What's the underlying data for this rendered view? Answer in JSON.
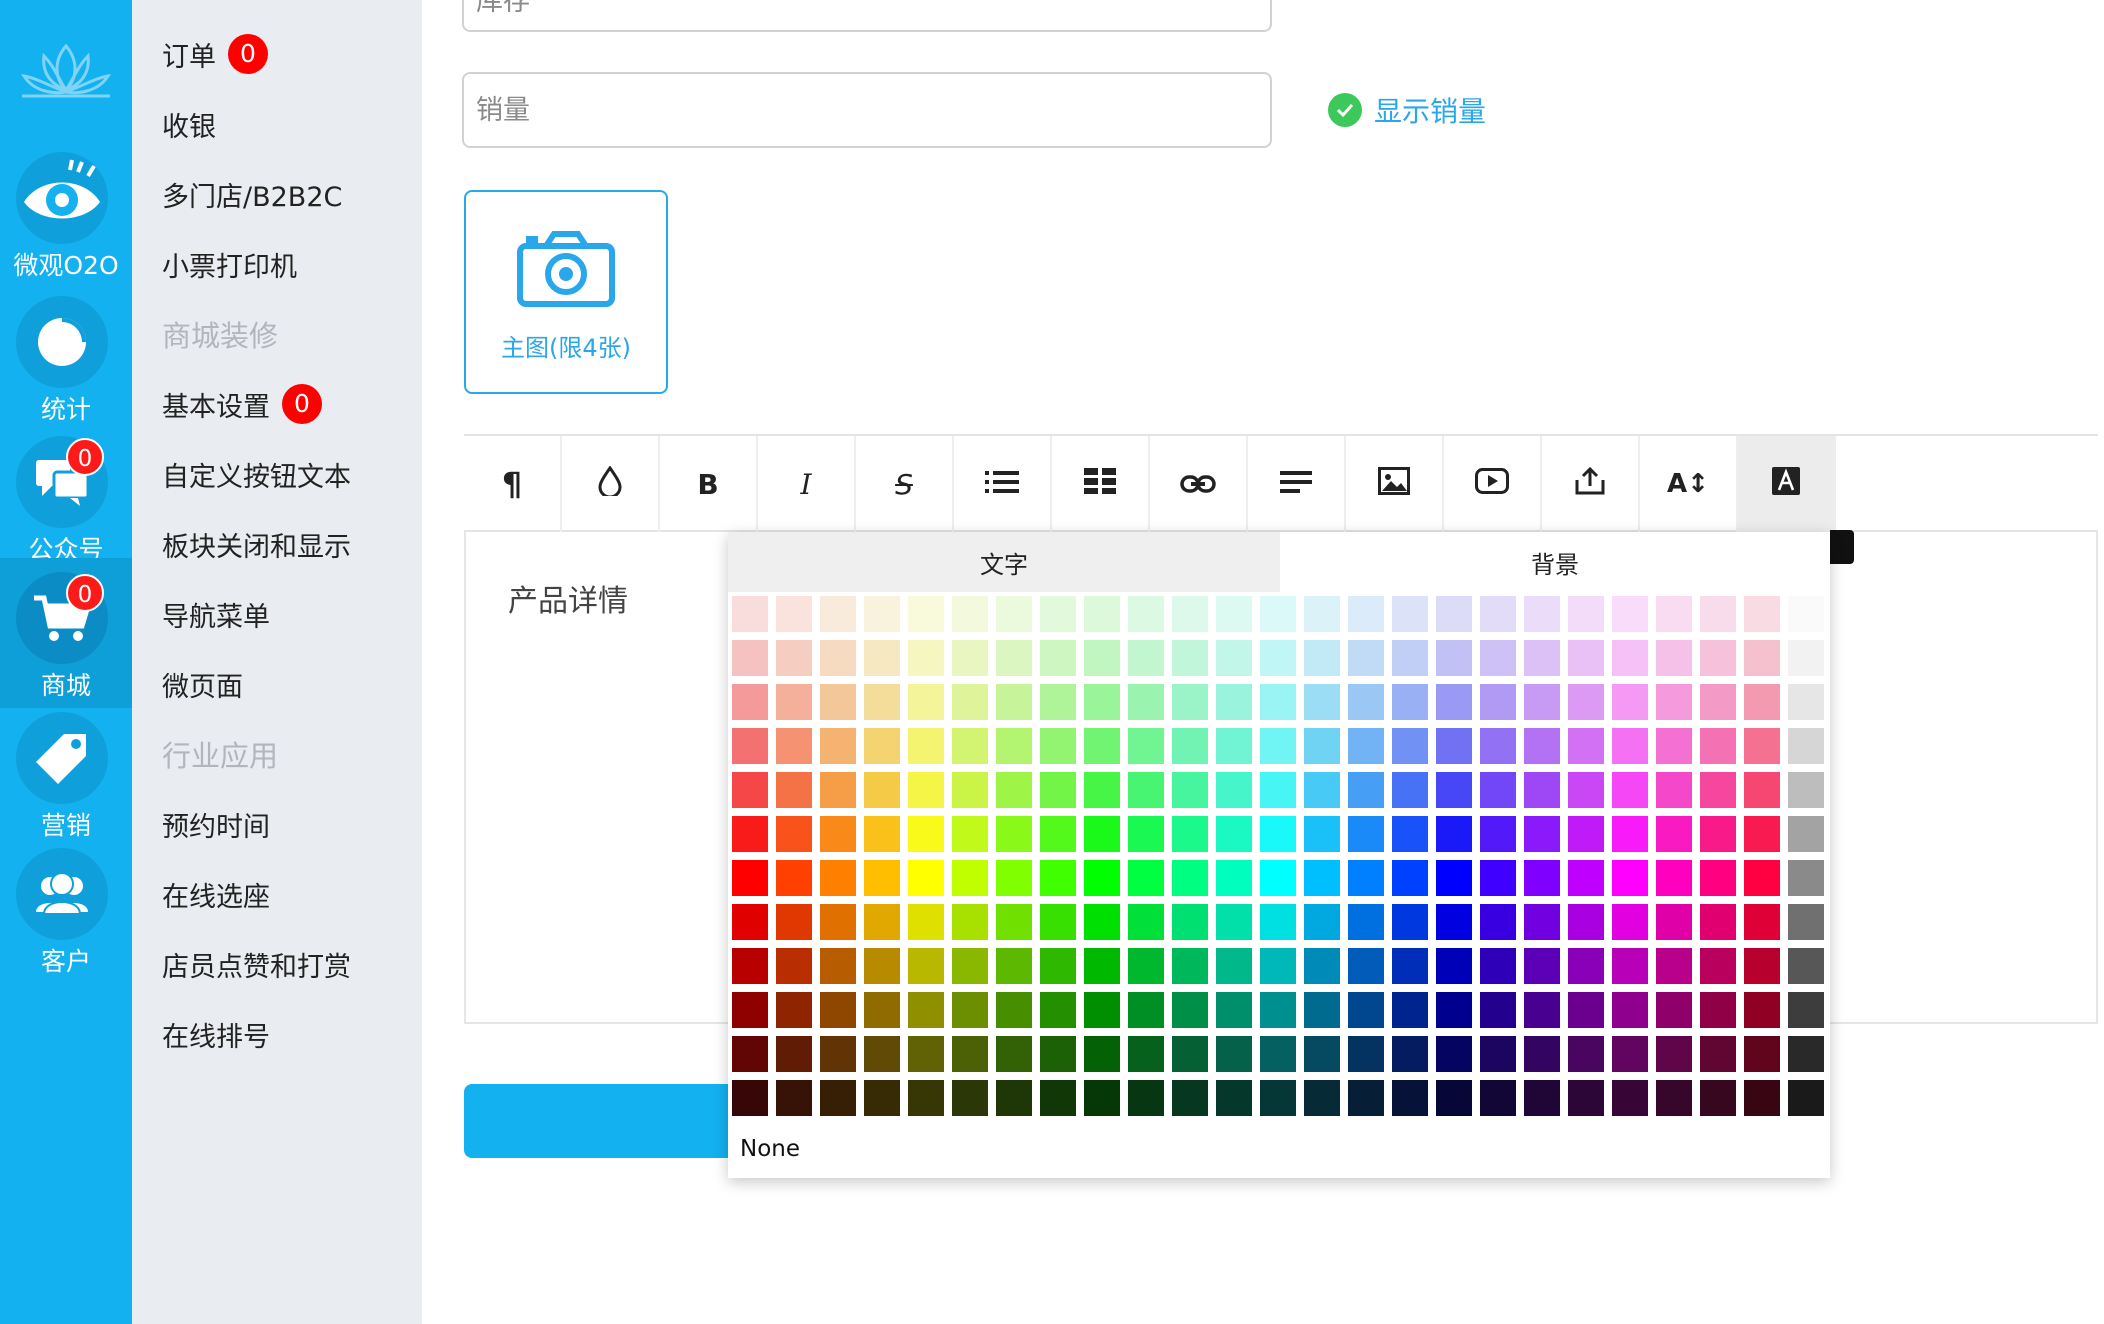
{
  "rail": {
    "items": [
      {
        "name": "weiguan-o2o",
        "label": "微观O2O",
        "icon": "eye-icon",
        "badge": null,
        "active": false
      },
      {
        "name": "stats",
        "label": "统计",
        "icon": "pie-chart-icon",
        "badge": null,
        "active": false
      },
      {
        "name": "official-account",
        "label": "公众号",
        "icon": "chat-bubbles-icon",
        "badge": "0",
        "active": false
      },
      {
        "name": "mall",
        "label": "商城",
        "icon": "shopping-cart-icon",
        "badge": "0",
        "active": true
      },
      {
        "name": "marketing",
        "label": "营销",
        "icon": "tag-icon",
        "badge": null,
        "active": false
      },
      {
        "name": "customers",
        "label": "客户",
        "icon": "users-icon",
        "badge": null,
        "active": false
      }
    ]
  },
  "side_menu": {
    "items": [
      {
        "label": "订单",
        "badge": "0",
        "section": false
      },
      {
        "label": "收银",
        "badge": null,
        "section": false
      },
      {
        "label": "多门店/B2B2C",
        "badge": null,
        "section": false
      },
      {
        "label": "小票打印机",
        "badge": null,
        "section": false
      },
      {
        "label": "商城装修",
        "badge": null,
        "section": true
      },
      {
        "label": "基本设置",
        "badge": "0",
        "section": false
      },
      {
        "label": "自定义按钮文本",
        "badge": null,
        "section": false
      },
      {
        "label": "板块关闭和显示",
        "badge": null,
        "section": false
      },
      {
        "label": "导航菜单",
        "badge": null,
        "section": false
      },
      {
        "label": "微页面",
        "badge": null,
        "section": false
      },
      {
        "label": "行业应用",
        "badge": null,
        "section": true
      },
      {
        "label": "预约时间",
        "badge": null,
        "section": false
      },
      {
        "label": "在线选座",
        "badge": null,
        "section": false
      },
      {
        "label": "店员点赞和打赏",
        "badge": null,
        "section": false
      },
      {
        "label": "在线排号",
        "badge": null,
        "section": false
      }
    ]
  },
  "form": {
    "stock_placeholder": "库存",
    "sales_placeholder": "销量",
    "show_sales_label": "显示销量",
    "main_image_label": "主图(限4张)",
    "editor_placeholder": "产品详情"
  },
  "toolbar": {
    "buttons": [
      {
        "name": "paragraph-icon",
        "glyph": "¶"
      },
      {
        "name": "color-drop-icon",
        "glyph": "drop"
      },
      {
        "name": "bold-icon",
        "glyph": "B"
      },
      {
        "name": "italic-icon",
        "glyph": "I"
      },
      {
        "name": "strikethrough-icon",
        "glyph": "S"
      },
      {
        "name": "list-icon",
        "glyph": "list"
      },
      {
        "name": "table-icon",
        "glyph": "table"
      },
      {
        "name": "link-icon",
        "glyph": "link"
      },
      {
        "name": "align-icon",
        "glyph": "align"
      },
      {
        "name": "image-icon",
        "glyph": "image"
      },
      {
        "name": "video-icon",
        "glyph": "video"
      },
      {
        "name": "upload-icon",
        "glyph": "upload"
      },
      {
        "name": "font-size-icon",
        "glyph": "A↕"
      },
      {
        "name": "font-color-icon",
        "glyph": "A",
        "active": true
      }
    ]
  },
  "color_picker": {
    "tab_text": "文字",
    "tab_background": "背景",
    "none_label": "None"
  },
  "colors": {
    "rail_bg": "#13b1ef",
    "accent": "#2aa7ea",
    "badge": "#ff0000",
    "check": "#3cc85a"
  }
}
